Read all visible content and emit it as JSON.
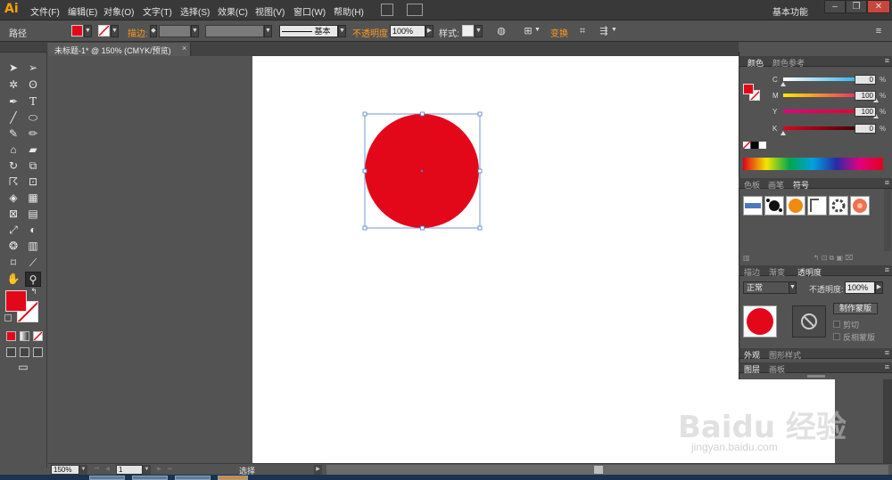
{
  "app": {
    "logo": "Ai"
  },
  "menu": {
    "items": [
      "文件(F)",
      "编辑(E)",
      "对象(O)",
      "文字(T)",
      "选择(S)",
      "效果(C)",
      "视图(V)",
      "窗口(W)",
      "帮助(H)"
    ],
    "workspace": "基本功能",
    "window_buttons": {
      "minimize": "–",
      "restore": "❐",
      "close": "✕"
    }
  },
  "control_bar": {
    "object_type": "路径",
    "stroke_label": "描边:",
    "stroke_style": "基本",
    "opacity_label": "不透明度",
    "opacity_value": "100%",
    "style_label": "样式:",
    "transform_label": "变换",
    "fill_color": "#e3071a"
  },
  "document": {
    "tab_title": "未标题-1* @ 150% (CMYK/预览)",
    "close": "×",
    "shape_fill": "#e3071a",
    "selection_color": "#4d7fc4"
  },
  "tools": {
    "fill_color": "#e3071a",
    "icons": [
      "selection-tool-icon",
      "direct-selection-tool-icon",
      "magic-wand-tool-icon",
      "lasso-tool-icon",
      "pen-tool-icon",
      "type-tool-icon",
      "line-tool-icon",
      "ellipse-tool-icon",
      "paintbrush-tool-icon",
      "pencil-tool-icon",
      "blob-brush-tool-icon",
      "eraser-tool-icon",
      "rotate-tool-icon",
      "scale-tool-icon",
      "warp-tool-icon",
      "free-transform-tool-icon",
      "shape-builder-tool-icon",
      "perspective-grid-tool-icon",
      "mesh-tool-icon",
      "gradient-tool-icon",
      "eyedropper-tool-icon",
      "blend-tool-icon",
      "symbol-sprayer-tool-icon",
      "column-graph-tool-icon",
      "artboard-tool-icon",
      "slice-tool-icon",
      "hand-tool-icon",
      "zoom-tool-icon"
    ]
  },
  "status_bar": {
    "zoom": "150%",
    "artboard_number": "1",
    "status": "选择"
  },
  "color_panel": {
    "tabs": [
      "颜色",
      "颜色参考"
    ],
    "sliders": [
      {
        "label": "C",
        "value": "0",
        "percent": 0,
        "from": "#ffffff",
        "to": "#00a0e9"
      },
      {
        "label": "M",
        "value": "100",
        "percent": 100,
        "from": "#ffea00",
        "to": "#e4007f"
      },
      {
        "label": "Y",
        "value": "100",
        "percent": 100,
        "from": "#e4007f",
        "to": "#e3001b"
      },
      {
        "label": "K",
        "value": "0",
        "percent": 0,
        "from": "#e3001b",
        "to": "#1a0000"
      }
    ],
    "percent_sign": "%"
  },
  "swatch_panel": {
    "tabs": [
      "色板",
      "画笔",
      "符号"
    ]
  },
  "transparency_panel": {
    "tabs": [
      "描边",
      "渐变",
      "透明度"
    ],
    "blend_mode": "正常",
    "opacity_label": "不透明度:",
    "opacity_value": "100%",
    "make_mask_button": "制作蒙版",
    "clip_label": "剪切",
    "invert_label": "反相蒙版"
  },
  "appearance_panel": {
    "tabs": [
      "外观",
      "图形样式"
    ]
  },
  "layers_panel": {
    "tabs": [
      "图层",
      "画板"
    ]
  },
  "watermark": {
    "main": "Baidu 经验",
    "sub": "jingyan.baidu.com"
  }
}
